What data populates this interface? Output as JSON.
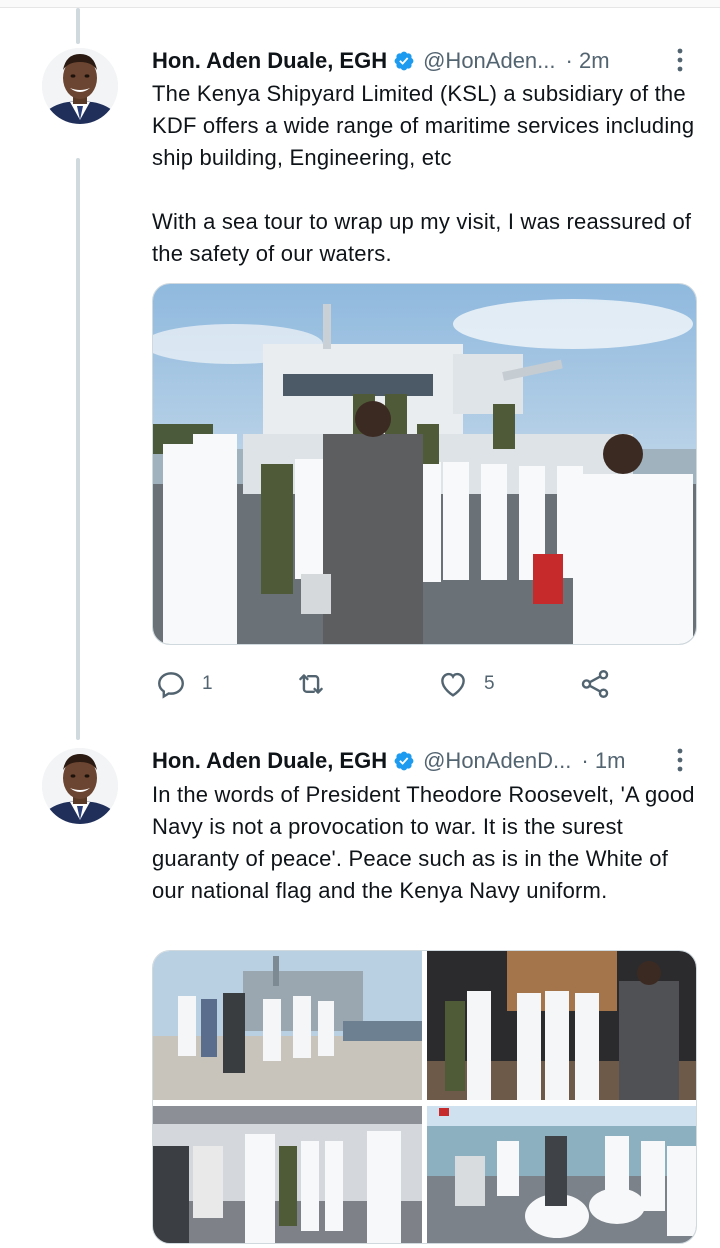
{
  "tweets": [
    {
      "author_name": "Hon. Aden Duale, EGH",
      "handle": "@HonAden...",
      "time": "· 2m",
      "text_p1": "The Kenya Shipyard Limited (KSL) a subsidiary of the KDF offers a wide range of maritime services including ship building, Engineering, etc",
      "text_p2": "With a sea tour to wrap up my visit, I was reassured of the safety of our waters.",
      "replies": "1",
      "retweets": "",
      "likes": "5"
    },
    {
      "author_name": "Hon. Aden Duale, EGH",
      "handle": "@HonAdenD...",
      "time": "· 1m",
      "text_p1": "In the words of President Theodore Roosevelt, 'A good Navy is not a provocation to war. It is the surest guaranty of peace'. Peace such as is in the White of our national flag and the Kenya Navy uniform."
    }
  ],
  "colors": {
    "verified": "#1d9bf0",
    "secondary_text": "#536471",
    "thread_line": "#cfd9de"
  },
  "icons": [
    "verified-badge-icon",
    "more-options-icon",
    "reply-icon",
    "retweet-icon",
    "like-icon",
    "share-icon"
  ]
}
